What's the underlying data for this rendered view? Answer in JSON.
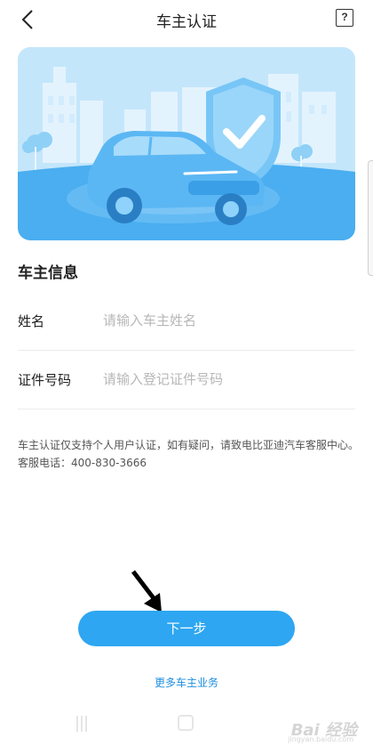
{
  "header": {
    "title": "车主认证",
    "help_label": "?"
  },
  "section": {
    "title": "车主信息"
  },
  "form": {
    "name": {
      "label": "姓名",
      "placeholder": "请输入车主姓名",
      "value": ""
    },
    "id_number": {
      "label": "证件号码",
      "placeholder": "请输入登记证件号码",
      "value": ""
    }
  },
  "notice": {
    "line1": "车主认证仅支持个人用户认证，如有疑问，请致电比亚迪汽车客服中心。",
    "line2": "客服电话：400-830-3666"
  },
  "actions": {
    "next_label": "下一步",
    "more_label": "更多车主业务"
  },
  "watermark": {
    "main": "Bai 经验",
    "sub": "jingyan.baidu.com"
  },
  "colors": {
    "primary": "#2ea6f1",
    "link": "#1e8fe0",
    "banner_bg": "#bfe4fb"
  },
  "icons": [
    "back-icon",
    "help-icon",
    "shield-check-icon",
    "car-illustration",
    "arrow-pointer-icon",
    "recent-apps-icon",
    "home-icon"
  ]
}
